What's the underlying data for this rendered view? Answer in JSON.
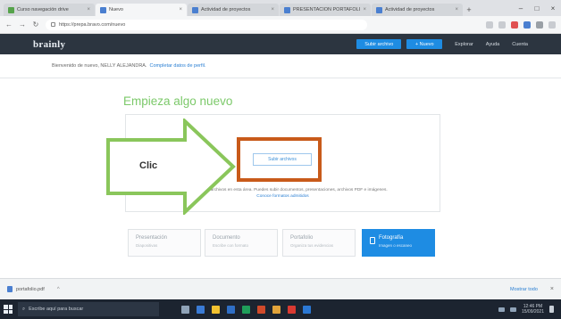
{
  "browser": {
    "tabs": [
      {
        "label": "Curso navegación drive",
        "active": false,
        "icon": "drive-icon"
      },
      {
        "label": "Nuevo",
        "active": true,
        "icon": "page-icon"
      },
      {
        "label": "Actividad de proyectos",
        "active": false,
        "icon": "page-icon"
      },
      {
        "label": "PRESENTACIÓN PORTAFOLIO",
        "active": false,
        "icon": "page-icon"
      },
      {
        "label": "Actividad de proyectos",
        "active": false,
        "icon": "page-icon"
      }
    ],
    "url": "https://prepa.bravo.com/nuevo"
  },
  "app": {
    "logo": "brainly",
    "nav": {
      "btn_upload": "Subir archivo",
      "btn_new": "+ Nuevo",
      "links": [
        "Explorar",
        "Ayuda",
        "Cuenta"
      ]
    },
    "welcome_text": "Bienvenido de nuevo, NELLY ALEJANDRA.",
    "welcome_link": "Completar datos de perfil.",
    "title": "Empieza algo nuevo",
    "drop_button": "Subir archivos",
    "hint_text": "Arrastra y suelta archivos en esta área. Puedes subir documentos, presentaciones, archivos PDF e imágenes.",
    "hint_link": "Conoce formatos admitidos",
    "tiles": [
      {
        "title": "Presentación",
        "subtitle": "Diapositivas"
      },
      {
        "title": "Documento",
        "subtitle": "Escribe con formato"
      },
      {
        "title": "Portafolio",
        "subtitle": "Organiza tus evidencias"
      },
      {
        "title": "Fotografía",
        "subtitle": "Imagen o escaneo"
      }
    ]
  },
  "annotation": {
    "clic_label": "Clic"
  },
  "downloads": {
    "file": "portafolio.pdf",
    "show_all": "Mostrar todo"
  },
  "taskbar": {
    "search_placeholder": "Escribe aquí para buscar",
    "time": "12:46 PM",
    "date": "15/09/2021"
  },
  "colors": {
    "accent": "#1e8ce3",
    "title_green": "#7cc96a",
    "annotation_orange": "#c85a1a",
    "arrow_green": "#8ac65b",
    "header_dark": "#2c3540"
  }
}
